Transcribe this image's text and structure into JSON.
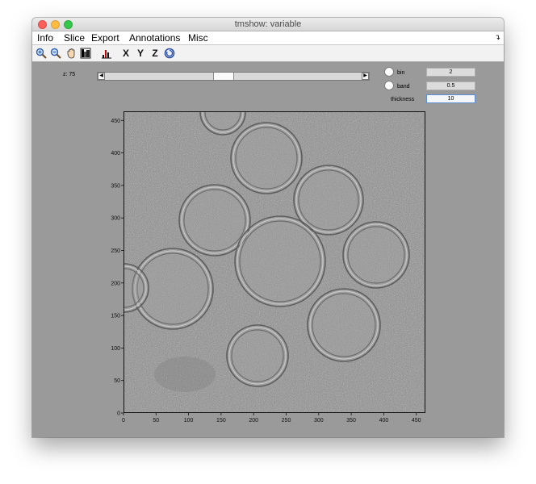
{
  "window": {
    "title": "tmshow: variable"
  },
  "menu": {
    "items": [
      "Info",
      "Slice",
      "Export",
      "Annotations",
      "Misc"
    ],
    "overflow_icon": "double-chevron-icon"
  },
  "toolbar": {
    "tools": [
      "zoom-in-icon",
      "zoom-out-icon",
      "pan-hand-icon",
      "colormap-icon",
      "histogram-icon"
    ],
    "axis_buttons": [
      "X",
      "Y",
      "Z"
    ],
    "rotate_icon": "rotate-icon"
  },
  "slice_control": {
    "label": "z: 75",
    "value": 75,
    "position_fraction": 0.46
  },
  "options": {
    "bin_label": "bin",
    "bin_value": "2",
    "band_label": "band",
    "band_value": "0.5",
    "thickness_label": "thickness",
    "thickness_value": "10"
  },
  "image_axes": {
    "x_ticks": [
      "0",
      "50",
      "100",
      "150",
      "200",
      "250",
      "300",
      "350",
      "400",
      "450"
    ],
    "y_ticks": [
      "0",
      "50",
      "100",
      "150",
      "200",
      "250",
      "300",
      "350",
      "400",
      "450"
    ],
    "x_range": [
      0,
      464
    ],
    "y_range": [
      0,
      464
    ]
  },
  "colors": {
    "window_bg": "#9a9a9a",
    "image_bg": "#8f8f8f"
  }
}
